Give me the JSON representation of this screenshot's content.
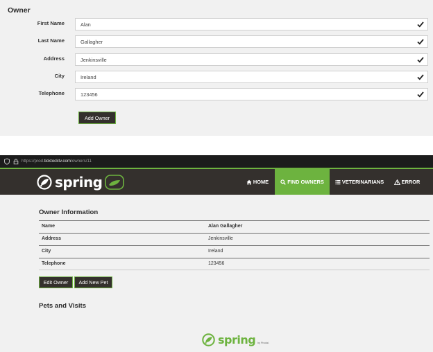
{
  "form": {
    "title": "Owner",
    "fields": [
      {
        "label": "First Name",
        "value": "Alan"
      },
      {
        "label": "Last Name",
        "value": "Gallagher"
      },
      {
        "label": "Address",
        "value": "Jenkinsville"
      },
      {
        "label": "City",
        "value": "Ireland"
      },
      {
        "label": "Telephone",
        "value": "123456"
      }
    ],
    "submit_label": "Add Owner"
  },
  "browser": {
    "url_prefix": "https://prod.",
    "url_host": "ticktocktv.com",
    "url_path": "/owners/11"
  },
  "navbar": {
    "logo_text": "spring",
    "items": [
      {
        "label": "HOME",
        "icon": "home-icon"
      },
      {
        "label": "FIND OWNERS",
        "icon": "search-icon"
      },
      {
        "label": "VETERINARIANS",
        "icon": "list-icon"
      },
      {
        "label": "ERROR",
        "icon": "warning-icon"
      }
    ],
    "active_color": "#6db33f",
    "bg_color": "#34302d"
  },
  "owner_info": {
    "heading": "Owner Information",
    "rows": [
      {
        "label": "Name",
        "value": "Alan Gallagher"
      },
      {
        "label": "Address",
        "value": "Jenkinsville"
      },
      {
        "label": "City",
        "value": "Ireland"
      },
      {
        "label": "Telephone",
        "value": "123456"
      }
    ],
    "edit_label": "Edit Owner",
    "add_pet_label": "Add New Pet"
  },
  "pets": {
    "heading": "Pets and Visits"
  },
  "footer": {
    "logo_text": "spring",
    "by_text": "by Pivotal."
  }
}
